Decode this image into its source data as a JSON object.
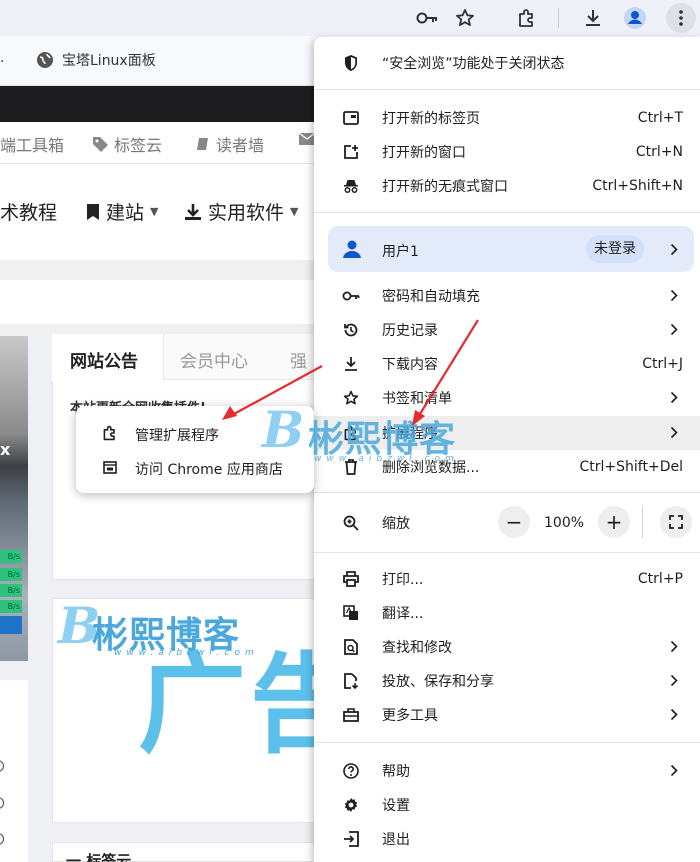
{
  "browser": {
    "bookmark": "宝塔Linux面板",
    "bookmark_dot": "."
  },
  "website": {
    "nav1": [
      "端工具箱",
      "标签云",
      "读者墙"
    ],
    "nav2": [
      "术教程",
      "建站",
      "实用软件"
    ],
    "notice_tabs": [
      "网站公告",
      "会员中心",
      "强"
    ],
    "notice_text": "本站更新全网收集插件!",
    "ad_text": "广告",
    "bottom_text": "一 标签云",
    "speed_tags": [
      "B/s",
      "B/s",
      "B/s",
      "B/s"
    ],
    "left_edge_glyph": "x"
  },
  "watermark": {
    "title": "彬熙博客",
    "subtitle": "www.aibzwl.com",
    "logo_letter": "B"
  },
  "menu": {
    "safe_browsing": "“安全浏览”功能处于关闭状态",
    "new_tab": "打开新的标签页",
    "new_tab_sc": "Ctrl+T",
    "new_window": "打开新的窗口",
    "new_window_sc": "Ctrl+N",
    "incognito": "打开新的无痕式窗口",
    "incognito_sc": "Ctrl+Shift+N",
    "profile": "用户1",
    "profile_status": "未登录",
    "passwords": "密码和自动填充",
    "history": "历史记录",
    "downloads": "下载内容",
    "downloads_sc": "Ctrl+J",
    "bookmarks": "书签和清单",
    "extensions": "扩展程序",
    "clear_data": "删除浏览数据...",
    "clear_data_sc": "Ctrl+Shift+Del",
    "zoom": "缩放",
    "zoom_minus": "−",
    "zoom_value": "100%",
    "zoom_plus": "+",
    "print": "打印...",
    "print_sc": "Ctrl+P",
    "translate": "翻译...",
    "find": "查找和修改",
    "cast": "投放、保存和分享",
    "more_tools": "更多工具",
    "help": "帮助",
    "settings": "设置",
    "exit": "退出"
  },
  "submenu": {
    "manage": "管理扩展程序",
    "webstore": "访问 Chrome 应用商店"
  },
  "colors": {
    "accent": "#0b57d0",
    "profile_bg": "#e3ebfb",
    "arrow_red": "#e52b2b",
    "watermark": "#4aa8dd"
  }
}
